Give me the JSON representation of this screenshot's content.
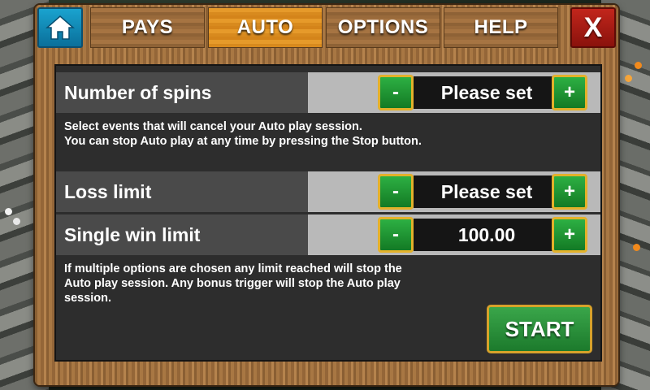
{
  "tabs": {
    "home_icon": "home-icon",
    "pays": "PAYS",
    "auto": "AUTO",
    "options": "OPTIONS",
    "help": "HELP",
    "close": "X"
  },
  "auto_panel": {
    "spins": {
      "label": "Number of spins",
      "value": "Please set",
      "minus": "-",
      "plus": "+"
    },
    "cancel_info": [
      "Select events that will cancel your Auto play session.",
      "You can stop Auto play at any time by pressing the Stop button."
    ],
    "loss_limit": {
      "label": "Loss limit",
      "value": "Please set",
      "minus": "-",
      "plus": "+"
    },
    "single_win_limit": {
      "label": "Single win limit",
      "value": "100.00",
      "minus": "-",
      "plus": "+"
    },
    "limit_info": [
      "If multiple options are chosen any limit reached will stop the",
      "Auto play session. Any bonus trigger will stop the Auto play",
      "session."
    ],
    "start_label": "START"
  },
  "colors": {
    "active_tab": "#e69a2a",
    "home_button": "#1aa3cf",
    "close_button": "#c2261c",
    "stepper_button": "#2db043",
    "button_border": "#e3b12a"
  }
}
